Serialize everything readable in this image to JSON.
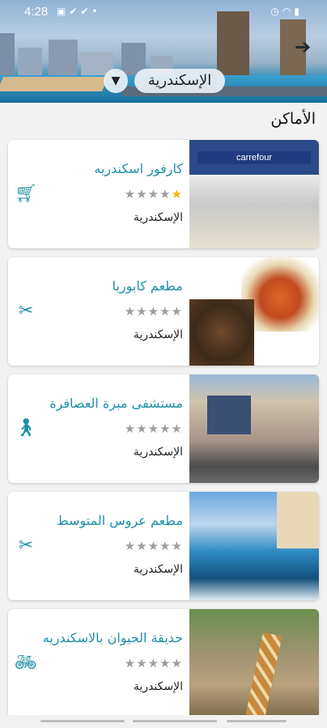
{
  "status_bar": {
    "time": "4:28",
    "left_icons": [
      "gallery-icon",
      "check-icon",
      "check-icon",
      "dot-icon"
    ],
    "right_icons": [
      "alarm-icon",
      "wifi-icon",
      "battery-icon"
    ]
  },
  "header": {
    "city_selector": {
      "value": "الإسكندرية",
      "dropdown_icon": "caret-down-icon"
    },
    "back_icon": "arrow-right-icon"
  },
  "section": {
    "title": "الأماكن"
  },
  "places": [
    {
      "name": "كارفور اسكندريه",
      "rating": 1,
      "max_rating": 5,
      "city": "الإسكندرية",
      "category_icon": "cart-icon",
      "image_sign": "carrefour"
    },
    {
      "name": "مطعم كابوريا",
      "rating": 0,
      "max_rating": 5,
      "city": "الإسكندرية",
      "category_icon": "restaurant-icon"
    },
    {
      "name": "مستشفى مبرة العصافرة",
      "rating": 0,
      "max_rating": 5,
      "city": "الإسكندرية",
      "category_icon": "walking-icon"
    },
    {
      "name": "مطعم عروس المتوسط",
      "rating": 0,
      "max_rating": 5,
      "city": "الإسكندرية",
      "category_icon": "restaurant-icon"
    },
    {
      "name": "حديقة الحيوان بالاسكندريه",
      "rating": 0,
      "max_rating": 5,
      "city": "الإسكندرية",
      "category_icon": "bicycle-icon"
    }
  ],
  "colors": {
    "accent": "#1e90a8",
    "star_on": "#f5b400",
    "star_off": "#9e9e9e"
  }
}
